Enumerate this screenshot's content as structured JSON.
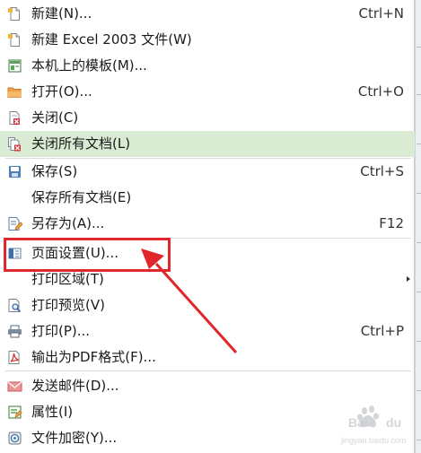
{
  "menu": {
    "items": [
      {
        "name": "new",
        "label": "新建(N)...",
        "shortcut": "Ctrl+N",
        "icon": "new-document-icon"
      },
      {
        "name": "new-excel2003",
        "label": "新建 Excel 2003 文件(W)",
        "shortcut": "",
        "icon": "new-document-icon"
      },
      {
        "name": "local-template",
        "label": "本机上的模板(M)...",
        "shortcut": "",
        "icon": "template-icon"
      },
      {
        "name": "open",
        "label": "打开(O)...",
        "shortcut": "Ctrl+O",
        "icon": "folder-icon"
      },
      {
        "name": "close",
        "label": "关闭(C)",
        "shortcut": "",
        "icon": "close-document-icon"
      },
      {
        "name": "close-all",
        "label": "关闭所有文档(L)",
        "shortcut": "",
        "icon": "close-all-icon",
        "highlighted": true
      },
      {
        "name": "save",
        "label": "保存(S)",
        "shortcut": "Ctrl+S",
        "icon": "save-icon"
      },
      {
        "name": "save-all",
        "label": "保存所有文档(E)",
        "shortcut": "",
        "icon": ""
      },
      {
        "name": "save-as",
        "label": "另存为(A)...",
        "shortcut": "F12",
        "icon": "save-as-icon"
      },
      {
        "name": "page-setup",
        "label": "页面设置(U)...",
        "shortcut": "",
        "icon": "page-setup-icon"
      },
      {
        "name": "print-area",
        "label": "打印区域(T)",
        "shortcut": "",
        "icon": "",
        "submenu": true
      },
      {
        "name": "print-preview",
        "label": "打印预览(V)",
        "shortcut": "",
        "icon": "print-preview-icon"
      },
      {
        "name": "print",
        "label": "打印(P)...",
        "shortcut": "Ctrl+P",
        "icon": "printer-icon"
      },
      {
        "name": "export-pdf",
        "label": "输出为PDF格式(F)...",
        "shortcut": "",
        "icon": "pdf-icon"
      },
      {
        "name": "send-mail",
        "label": "发送邮件(D)...",
        "shortcut": "",
        "icon": "mail-icon"
      },
      {
        "name": "properties",
        "label": "属性(I)",
        "shortcut": "",
        "icon": "properties-icon"
      },
      {
        "name": "encrypt",
        "label": "文件加密(Y)...",
        "shortcut": "",
        "icon": "lock-icon"
      }
    ]
  },
  "colors": {
    "highlight": "#d9ecd3",
    "annotation": "#e0262b"
  },
  "watermark": {
    "brand": "Bai du",
    "sub": "jingyan.baidu.com"
  }
}
